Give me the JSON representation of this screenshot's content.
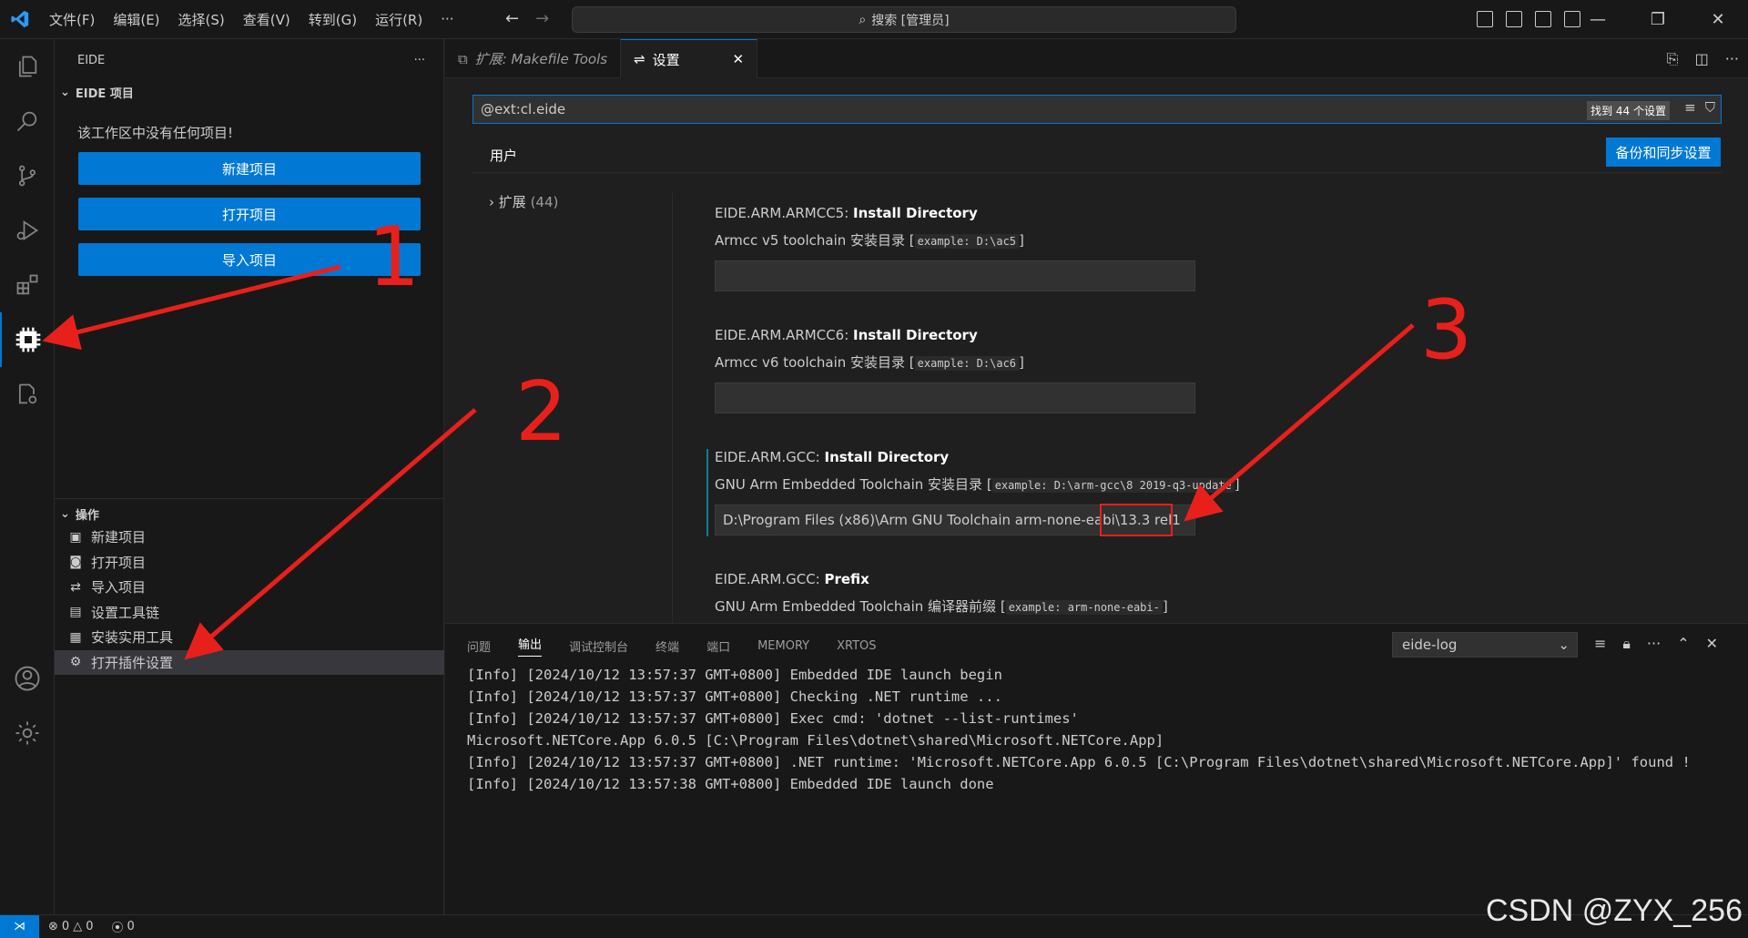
{
  "titlebar": {
    "menu": [
      "文件(F)",
      "编辑(E)",
      "选择(S)",
      "查看(V)",
      "转到(G)",
      "运行(R)",
      "···"
    ],
    "search_text": "搜索 [管理员]"
  },
  "sidebar": {
    "title": "EIDE",
    "section_projects": "EIDE 项目",
    "empty_message": "该工作区中没有任何项目!",
    "buttons": [
      "新建项目",
      "打开项目",
      "导入项目"
    ],
    "section_ops": "操作",
    "ops": [
      "新建项目",
      "打开项目",
      "导入项目",
      "设置工具链",
      "安装实用工具",
      "打开插件设置"
    ]
  },
  "editor": {
    "tabs": [
      {
        "label": "扩展: Makefile Tools"
      },
      {
        "label": "设置"
      }
    ],
    "search_value": "@ext:cl.eide",
    "found_badge": "找到 44 个设置",
    "user_tab": "用户",
    "sync_button": "备份和同步设置",
    "toc_label": "扩展",
    "toc_count": "(44)",
    "settings": [
      {
        "category": "EIDE.ARM.ARMCC5: ",
        "name": "Install Directory",
        "desc": "Armcc v5 toolchain 安装目录",
        "example": "example: D:\\ac5",
        "value": ""
      },
      {
        "category": "EIDE.ARM.ARMCC6: ",
        "name": "Install Directory",
        "desc": "Armcc v6 toolchain 安装目录",
        "example": "example: D:\\ac6",
        "value": ""
      },
      {
        "category": "EIDE.ARM.GCC: ",
        "name": "Install Directory",
        "desc": "GNU Arm Embedded Toolchain 安装目录",
        "example": "example: D:\\arm-gcc\\8 2019-q3-update",
        "value": "D:\\Program Files (x86)\\Arm GNU Toolchain arm-none-eabi\\13.3 rel1"
      },
      {
        "category": "EIDE.ARM.GCC: ",
        "name": "Prefix",
        "desc": "GNU Arm Embedded Toolchain 编译器前缀",
        "example": "example: arm-none-eabi-",
        "value": ""
      }
    ]
  },
  "panel": {
    "tabs": [
      "问题",
      "输出",
      "调试控制台",
      "终端",
      "端口",
      "MEMORY",
      "XRTOS"
    ],
    "active_tab": "输出",
    "channel": "eide-log",
    "log": "[Info] [2024/10/12 13:57:37 GMT+0800] Embedded IDE launch begin\n[Info] [2024/10/12 13:57:37 GMT+0800] Checking .NET runtime ...\n[Info] [2024/10/12 13:57:37 GMT+0800] Exec cmd: 'dotnet --list-runtimes'\nMicrosoft.NETCore.App 6.0.5 [C:\\Program Files\\dotnet\\shared\\Microsoft.NETCore.App]\n[Info] [2024/10/12 13:57:37 GMT+0800] .NET runtime: 'Microsoft.NETCore.App 6.0.5 [C:\\Program Files\\dotnet\\shared\\Microsoft.NETCore.App]' found !\n[Info] [2024/10/12 13:57:38 GMT+0800] Embedded IDE launch done"
  },
  "statusbar": {
    "errors": "0",
    "warnings": "0",
    "ports": "0"
  },
  "annotations": {
    "numbers": [
      "1",
      "2",
      "3"
    ],
    "watermark": "CSDN @ZYX_256"
  },
  "colors": {
    "accent": "#0078d4",
    "annotation_red": "#e8201b"
  }
}
